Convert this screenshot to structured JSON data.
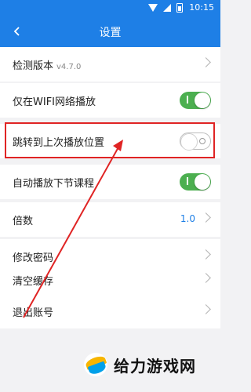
{
  "statusbar": {
    "time": "10:15"
  },
  "header": {
    "title": "设置"
  },
  "settings": {
    "check_version": {
      "label": "检测版本",
      "version": "v4.7.0"
    },
    "wifi_only": {
      "label": "仅在WIFI网络播放",
      "on": true
    },
    "resume": {
      "label": "跳转到上次播放位置",
      "on": false
    },
    "autoplay": {
      "label": "自动播放下节课程",
      "on": true
    },
    "speed": {
      "label": "倍数",
      "value": "1.0"
    },
    "change_password": {
      "label": "修改密码"
    },
    "clear_cache": {
      "label": "清空缓存"
    },
    "logout": {
      "label": "退出账号"
    }
  },
  "watermark": {
    "text": "给力游戏网"
  },
  "colors": {
    "accent": "#1e7fe6",
    "toggle_on": "#4caf50",
    "highlight": "#e02424"
  }
}
